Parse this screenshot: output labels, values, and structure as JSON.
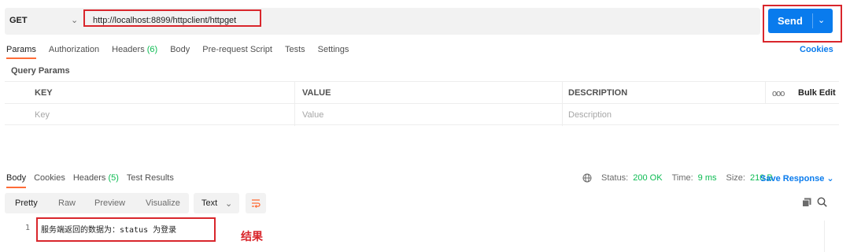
{
  "request": {
    "method": "GET",
    "url": "http://localhost:8899/httpclient/httpget",
    "send_label": "Send"
  },
  "request_tabs": [
    {
      "label": "Params",
      "count": "",
      "active": true
    },
    {
      "label": "Authorization",
      "count": "",
      "active": false
    },
    {
      "label": "Headers",
      "count": "(6)",
      "active": false
    },
    {
      "label": "Body",
      "count": "",
      "active": false
    },
    {
      "label": "Pre-request Script",
      "count": "",
      "active": false
    },
    {
      "label": "Tests",
      "count": "",
      "active": false
    },
    {
      "label": "Settings",
      "count": "",
      "active": false
    }
  ],
  "cookies_link": "Cookies",
  "query_params": {
    "title": "Query Params",
    "columns": {
      "key": "KEY",
      "value": "VALUE",
      "description": "DESCRIPTION",
      "more": "ooo",
      "bulk_edit": "Bulk Edit"
    },
    "placeholders": {
      "key": "Key",
      "value": "Value",
      "description": "Description"
    }
  },
  "response_tabs": [
    {
      "label": "Body",
      "count": "",
      "active": true
    },
    {
      "label": "Cookies",
      "count": "",
      "active": false
    },
    {
      "label": "Headers",
      "count": "(5)",
      "active": false
    },
    {
      "label": "Test Results",
      "count": "",
      "active": false
    }
  ],
  "response_status": {
    "status_label": "Status:",
    "status_value": "200 OK",
    "time_label": "Time:",
    "time_value": "9 ms",
    "size_label": "Size:",
    "size_value": "210 B",
    "save_label": "Save Response"
  },
  "response_view": {
    "formats": [
      "Pretty",
      "Raw",
      "Preview",
      "Visualize"
    ],
    "active_format": "Pretty",
    "language": "Text"
  },
  "response_body": {
    "line_number": "1",
    "line_text": "服务端返回的数据为：status 为登录"
  },
  "annotation": "结果",
  "colors": {
    "accent": "#097bed",
    "active_tab": "#ff6c37",
    "ok": "#0cbb52",
    "highlight": "#d9262c"
  },
  "icons": [
    "chevron-down-icon",
    "globe-icon",
    "wrap-lines-icon",
    "copy-icon",
    "search-icon"
  ]
}
